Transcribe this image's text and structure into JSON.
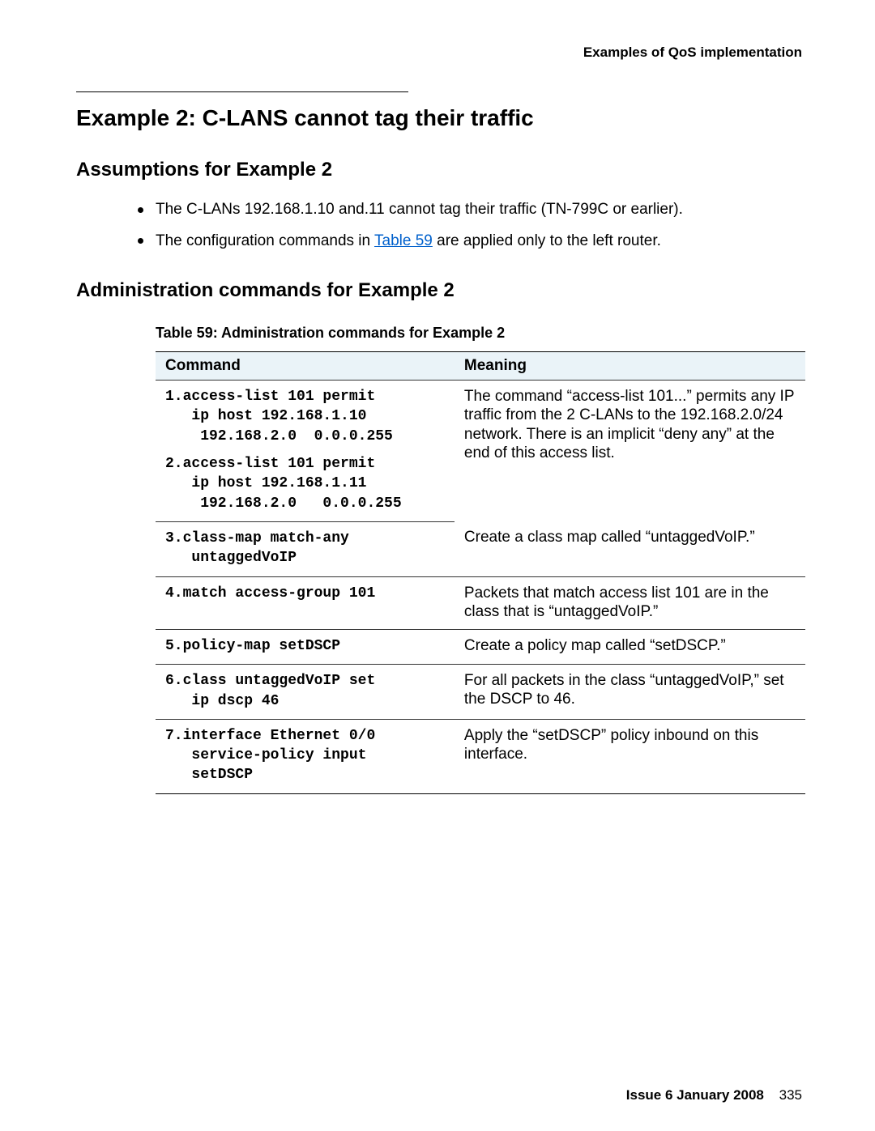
{
  "running_head": "Examples of QoS implementation",
  "title": "Example 2: C-LANS cannot tag their traffic",
  "assumptions_heading": "Assumptions for Example 2",
  "bullets": {
    "b0": "The C-LANs 192.168.1.10 and.11 cannot tag their traffic (TN-799C or earlier).",
    "b1_pre": "The configuration commands in ",
    "b1_link": "Table 59",
    "b1_post": " are applied only to the left router."
  },
  "admin_heading": "Administration commands for Example 2",
  "table_caption": "Table 59: Administration commands for Example 2",
  "th_command": "Command",
  "th_meaning": "Meaning",
  "rows": {
    "r0_cmd": "1.access-list 101 permit\n   ip host 192.168.1.10\n    192.168.2.0  0.0.0.255",
    "r0b_cmd": "2.access-list 101 permit\n   ip host 192.168.1.11\n    192.168.2.0   0.0.0.255",
    "r0_meaning": "The command “access-list 101...” permits any IP traffic from the 2 C-LANs to the 192.168.2.0/24 network. There is an implicit “deny any” at the end of this access list.",
    "r1_cmd": "3.class-map match-any\n   untaggedVoIP",
    "r1_meaning": "Create a class map called “untaggedVoIP.”",
    "r2_cmd": "4.match access-group 101",
    "r2_meaning": "Packets that match access list 101 are in the class that is “untaggedVoIP.”",
    "r3_cmd": "5.policy-map setDSCP",
    "r3_meaning": "Create a policy map called “setDSCP.”",
    "r4_cmd": "6.class untaggedVoIP set\n   ip dscp 46",
    "r4_meaning": "For all packets in the class “untaggedVoIP,” set the DSCP to 46.",
    "r5_cmd": "7.interface Ethernet 0/0\n   service-policy input\n   setDSCP",
    "r5_meaning": "Apply the “setDSCP” policy inbound on this interface."
  },
  "footer_issue": "Issue 6   January 2008",
  "footer_page": "335"
}
